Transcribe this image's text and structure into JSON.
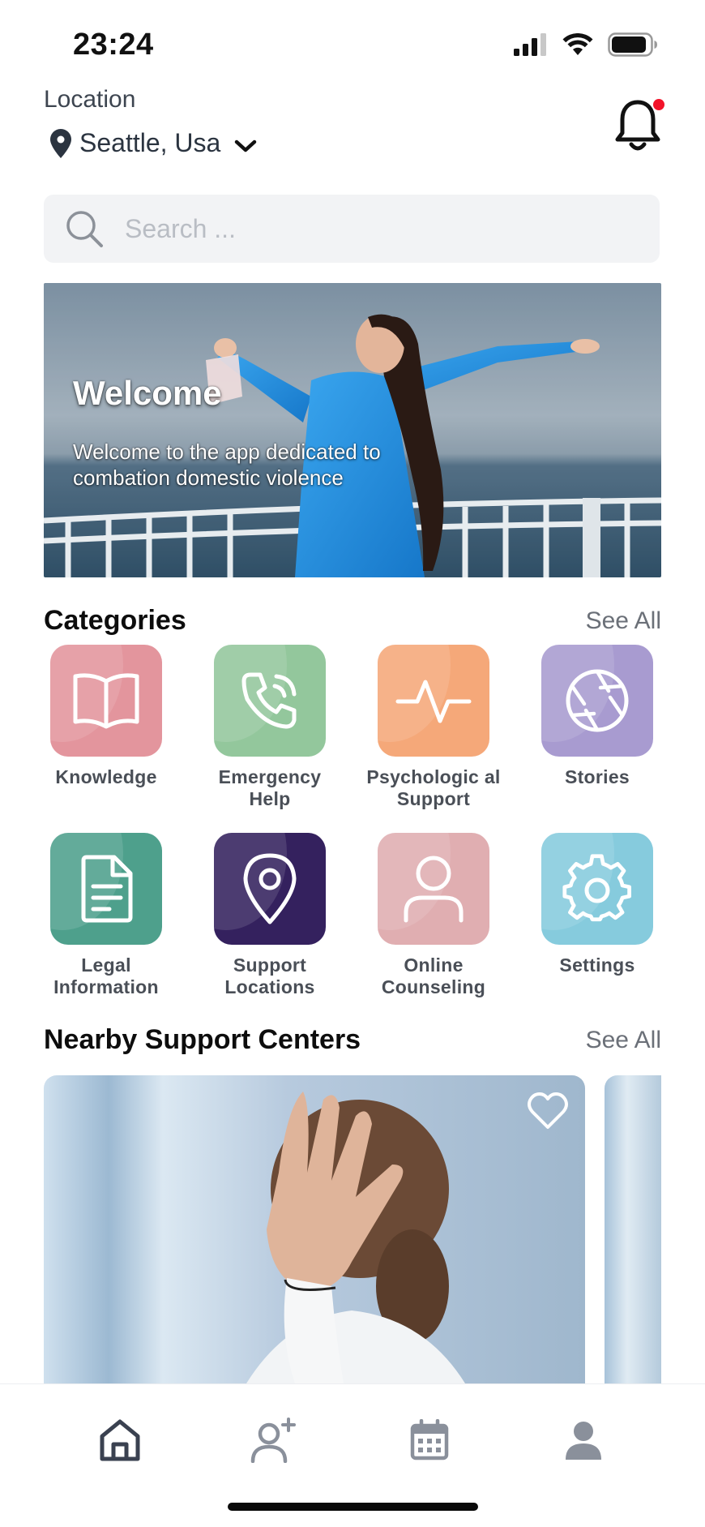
{
  "status": {
    "time": "23:24"
  },
  "location": {
    "label": "Location",
    "city": "Seattle, Usa"
  },
  "search": {
    "placeholder": "Search ..."
  },
  "hero": {
    "title": "Welcome",
    "subtitle": "Welcome to the app dedicated to combation domestic violence"
  },
  "categories": {
    "title": "Categories",
    "see_all": "See All",
    "items": [
      {
        "label": "Knowledge",
        "icon": "book-open-icon",
        "color": "#e3959d"
      },
      {
        "label": "Emergency Help",
        "icon": "phone-ringing-icon",
        "color": "#93c79c"
      },
      {
        "label": "Psychologic al Support",
        "icon": "pulse-icon",
        "color": "#f5a879"
      },
      {
        "label": "Stories",
        "icon": "aperture-icon",
        "color": "#a89bd0"
      },
      {
        "label": "Legal Information",
        "icon": "document-icon",
        "color": "#4ea08c"
      },
      {
        "label": "Support Locations",
        "icon": "map-pin-icon",
        "color": "#34215e"
      },
      {
        "label": "Online Counseling",
        "icon": "user-icon",
        "color": "#e0aeb1"
      },
      {
        "label": "Settings",
        "icon": "gear-icon",
        "color": "#86cbdd"
      }
    ]
  },
  "nearby": {
    "title": "Nearby Support Centers",
    "see_all": "See All"
  },
  "tabbar": {
    "items": [
      {
        "name": "home",
        "icon": "home-icon",
        "active": true
      },
      {
        "name": "add-contact",
        "icon": "user-plus-icon",
        "active": false
      },
      {
        "name": "calendar",
        "icon": "calendar-icon",
        "active": false
      },
      {
        "name": "profile",
        "icon": "profile-icon",
        "active": false
      }
    ]
  },
  "colors": {
    "notification_dot": "#f3142a",
    "active_tab": "#3a4150",
    "inactive_tab": "#8a909b"
  }
}
